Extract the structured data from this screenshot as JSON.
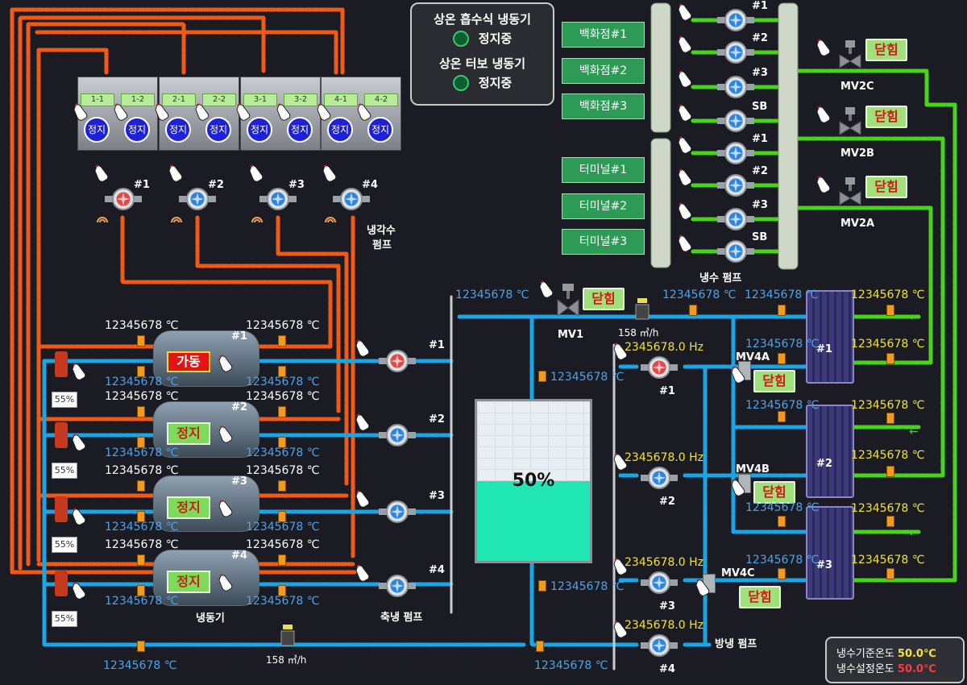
{
  "status_panel": {
    "absorption_title": "상온 흡수식 냉동기",
    "absorption_status": "정지중",
    "turbo_title": "상온 터보 냉동기",
    "turbo_status": "정지중"
  },
  "consumers": [
    "백화점#1",
    "백화점#2",
    "백화점#3",
    "터미널#1",
    "터미널#2",
    "터미널#3"
  ],
  "cold_pump_labels": [
    "#1",
    "#2",
    "#3",
    "SB",
    "#1",
    "#2",
    "#3",
    "SB"
  ],
  "cold_pump_group_label": "냉수 펌프",
  "valves_mv2": [
    {
      "name": "MV2C",
      "state": "닫힘"
    },
    {
      "name": "MV2B",
      "state": "닫힘"
    },
    {
      "name": "MV2A",
      "state": "닫힘"
    }
  ],
  "tower_cells": [
    "1-1",
    "1-2",
    "2-1",
    "2-2",
    "3-1",
    "3-2",
    "4-1",
    "4-2"
  ],
  "tower_fan_status": "정지",
  "cooling_pumps": [
    "#1",
    "#2",
    "#3",
    "#4"
  ],
  "cooling_pump_label_1": "냉각수",
  "cooling_pump_label_2": "펌프",
  "chillers": [
    {
      "id": "#1",
      "state": "가동",
      "running": true,
      "valve_pct": "55%"
    },
    {
      "id": "#2",
      "state": "정지",
      "running": false,
      "valve_pct": "55%"
    },
    {
      "id": "#3",
      "state": "정지",
      "running": false,
      "valve_pct": "55%"
    },
    {
      "id": "#4",
      "state": "정지",
      "running": false,
      "valve_pct": "55%"
    }
  ],
  "chiller_group_label": "냉동기",
  "temp_value": "12345678 ℃",
  "storage_pumps": [
    "#1",
    "#2",
    "#3",
    "#4"
  ],
  "storage_pump_label": "축냉 펌프",
  "mv1": {
    "name": "MV1",
    "state": "닫힘"
  },
  "flow_value": "158 ㎥/h",
  "tank": {
    "level": 0.5,
    "level_text": "50%"
  },
  "discharge_pumps": [
    {
      "id": "#1",
      "freq": "2345678.0 Hz"
    },
    {
      "id": "#2",
      "freq": "2345678.0 Hz"
    },
    {
      "id": "#3",
      "freq": "2345678.0 Hz"
    },
    {
      "id": "#4",
      "freq": "2345678.0 Hz"
    }
  ],
  "discharge_pump_label": "방냉 펌프",
  "mv4": [
    {
      "name": "MV4A",
      "state": "닫힘"
    },
    {
      "name": "MV4B",
      "state": "닫힘"
    },
    {
      "name": "MV4C",
      "state": "닫힘"
    }
  ],
  "heat_exchangers": [
    "#1",
    "#2",
    "#3"
  ],
  "reference": {
    "ref_label": "냉수기준온도",
    "ref_value": "50.0℃",
    "set_label": "냉수설정온도",
    "set_value": "50.0℃"
  },
  "colors": {
    "hot_pipe": "#f05a14",
    "cold_pipe": "#1aa6e6",
    "green_pipe": "#48d418",
    "run": "#e51414",
    "stop": "#7ddb5a"
  }
}
